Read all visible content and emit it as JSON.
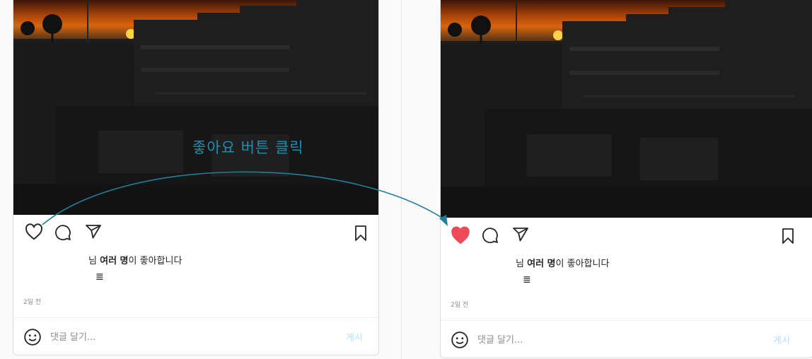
{
  "annotation": {
    "label": "좋아요 버튼 클릭"
  },
  "posts": [
    {
      "state": "before",
      "liked": false,
      "likes_suffix": "님",
      "likes_bold": "여러 명",
      "likes_tail": "이 좋아합니다",
      "caption_glyph": "≣",
      "time": "2일 전",
      "comment_placeholder": "댓글 달기...",
      "post_label": "게시"
    },
    {
      "state": "after",
      "liked": true,
      "like_color": "#ed4956",
      "likes_suffix": "님",
      "likes_bold": "여러 명",
      "likes_tail": "이 좋아합니다",
      "caption_glyph": "≣",
      "time": "2일 전",
      "comment_placeholder": "댓글 달기...",
      "post_label": "게시"
    }
  ]
}
